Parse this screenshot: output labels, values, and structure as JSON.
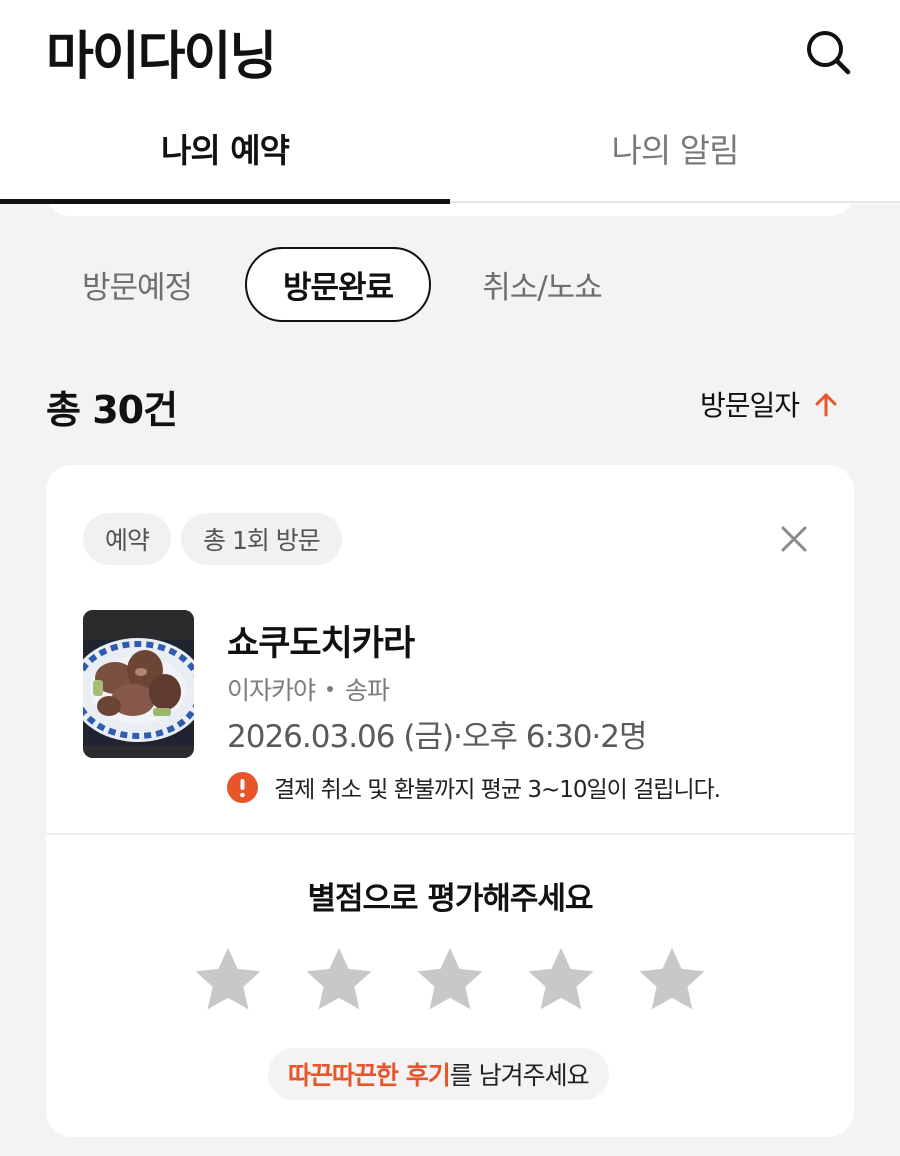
{
  "header": {
    "title": "마이다이닝"
  },
  "icons": {
    "search": "search-icon",
    "close": "close-icon",
    "sort_arrow": "arrow-up-icon",
    "info": "info-icon",
    "star": "star-icon"
  },
  "tabs": [
    {
      "label": "나의 예약",
      "active": true
    },
    {
      "label": "나의 알림",
      "active": false
    }
  ],
  "filters": [
    {
      "label": "방문예정",
      "selected": false
    },
    {
      "label": "방문완료",
      "selected": true
    },
    {
      "label": "취소/노쇼",
      "selected": false
    }
  ],
  "list": {
    "count_label": "총 30건",
    "sort_label": "방문일자"
  },
  "reservation": {
    "badges": [
      "예약",
      "총 1회 방문"
    ],
    "name": "쇼쿠도치카라",
    "category": "이자카야",
    "area": "송파",
    "visit_info": "2026.03.06 (금)·오후 6:30·2명",
    "notice": "결제 취소 및 환불까지 평균 3~10일이 걸립니다.",
    "rating": {
      "title": "별점으로 평가해주세요",
      "stars_total": 5,
      "stars_selected": 0
    },
    "review": {
      "highlight": "따끈따끈한 후기",
      "rest": "를 남겨주세요"
    }
  },
  "colors": {
    "accent": "#e8552b",
    "star_empty": "#c8c8c8",
    "background": "#f3f3f4",
    "card": "#ffffff",
    "text_primary": "#111111"
  }
}
